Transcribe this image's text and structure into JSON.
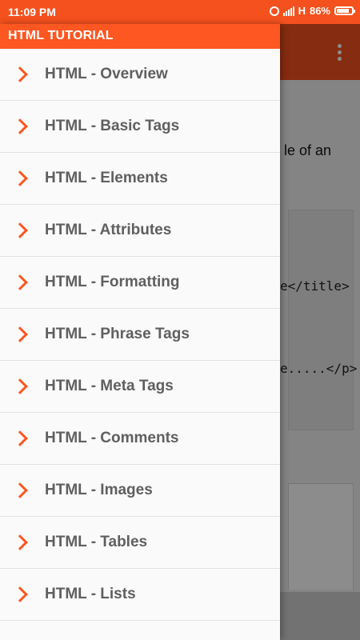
{
  "status_bar": {
    "time": "11:09 PM",
    "network": "H",
    "battery": "86%"
  },
  "background": {
    "text_fragment": "le of an",
    "code_line_1": "e</title>",
    "code_line_2": "e.....</p>"
  },
  "drawer": {
    "title": "HTML TUTORIAL",
    "items": [
      {
        "label": "HTML - Overview"
      },
      {
        "label": "HTML - Basic Tags"
      },
      {
        "label": "HTML - Elements"
      },
      {
        "label": "HTML - Attributes"
      },
      {
        "label": "HTML - Formatting"
      },
      {
        "label": "HTML - Phrase Tags"
      },
      {
        "label": "HTML - Meta Tags"
      },
      {
        "label": "HTML - Comments"
      },
      {
        "label": "HTML - Images"
      },
      {
        "label": "HTML - Tables"
      },
      {
        "label": "HTML - Lists"
      }
    ]
  },
  "colors": {
    "accent": "#ff5722",
    "item_text": "#5f5f5f"
  }
}
